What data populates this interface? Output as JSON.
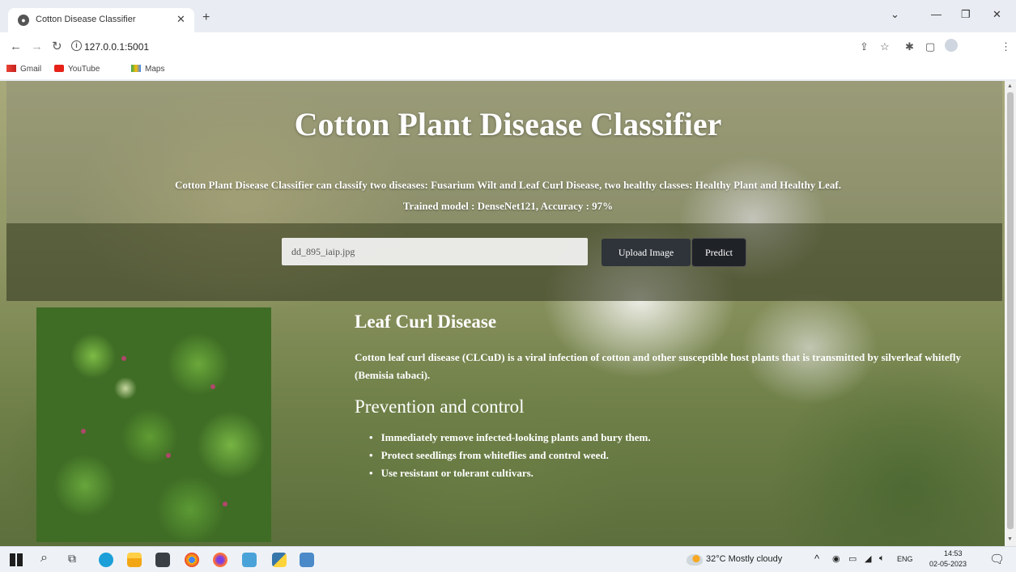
{
  "browser": {
    "tab_title": "Cotton Disease Classifier",
    "url": "127.0.0.1:5001",
    "bookmarks": [
      "Gmail",
      "YouTube",
      "Maps"
    ]
  },
  "page": {
    "title": "Cotton Plant Disease Classifier",
    "description_line1": "Cotton Plant Disease Classifier can classify two diseases: Fusarium Wilt and Leaf Curl Disease, two healthy classes: Healthy Plant and Healthy Leaf.",
    "description_line2": "Trained model : DenseNet121, Accuracy : 97%",
    "file_name": "dd_895_iaip.jpg",
    "upload_label": "Upload Image",
    "predict_label": "Predict",
    "result_title": "Leaf Curl Disease",
    "result_description": "Cotton leaf curl disease (CLCuD) is a viral infection of cotton and other susceptible host plants that is transmitted by silverleaf whitefly (Bemisia tabaci).",
    "prevention_title": "Prevention and control",
    "prevention_tips": [
      "Immediately remove infected-looking plants and bury them.",
      "Protect seedlings from whiteflies and control weed.",
      "Use resistant or tolerant cultivars."
    ]
  },
  "taskbar": {
    "weather": "32°C  Mostly cloudy",
    "language": "ENG",
    "time": "14:53",
    "date": "02-05-2023"
  }
}
